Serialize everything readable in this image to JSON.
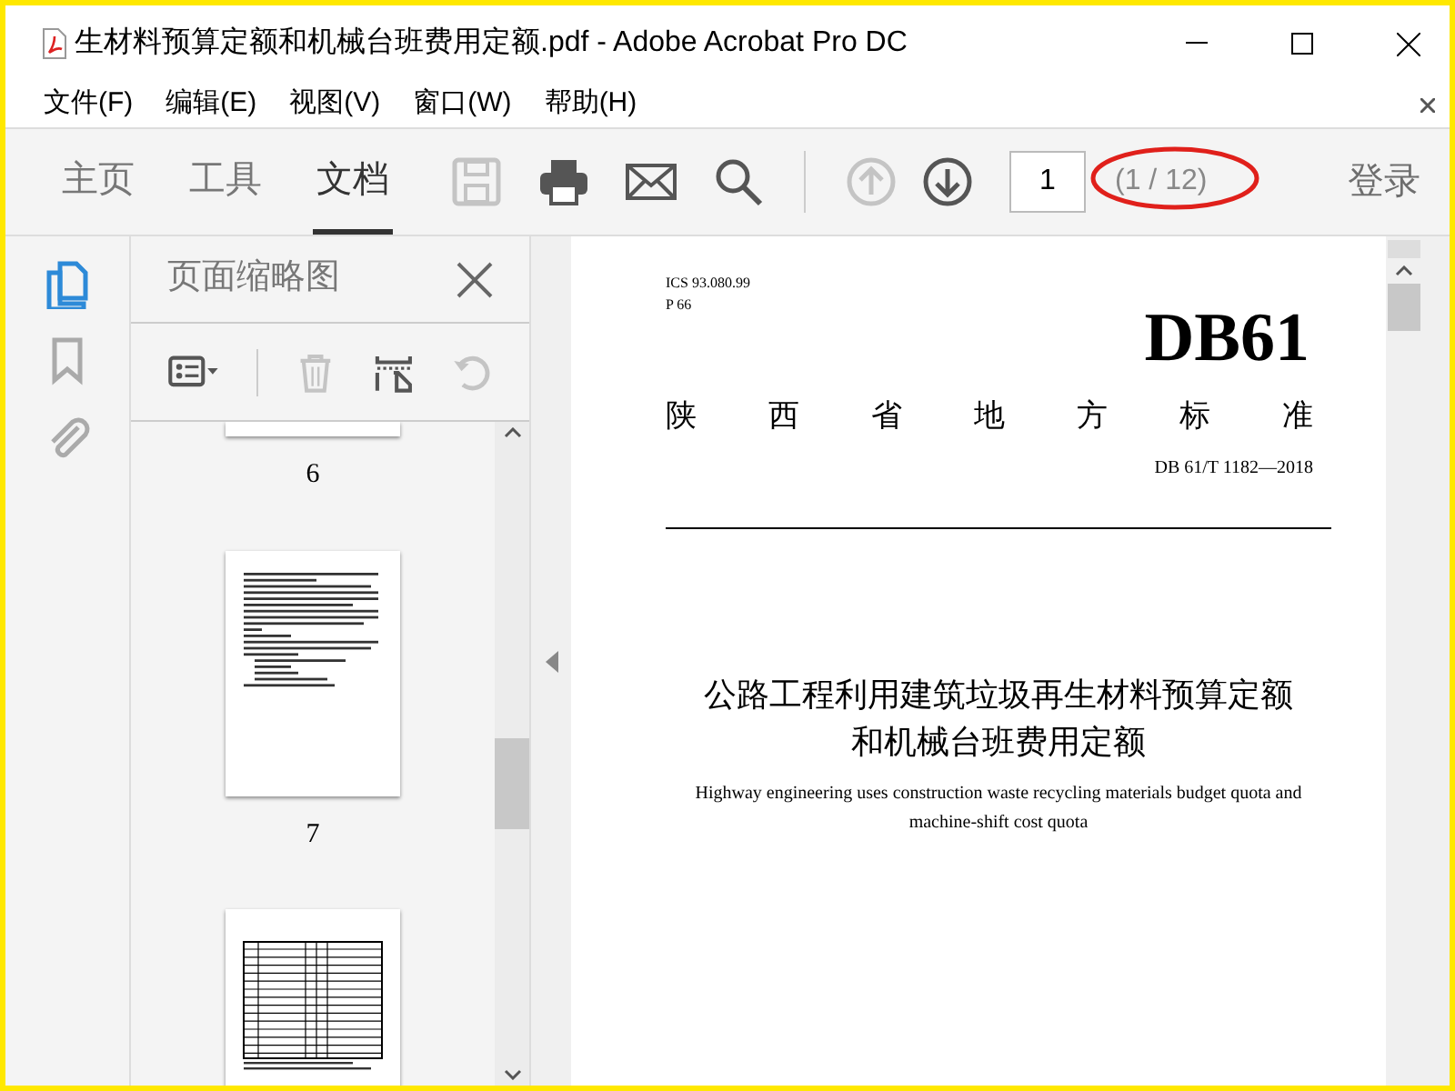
{
  "window": {
    "title": "生材料预算定额和机械台班费用定额.pdf - Adobe Acrobat Pro DC"
  },
  "menu": [
    "文件(F)",
    "编辑(E)",
    "视图(V)",
    "窗口(W)",
    "帮助(H)"
  ],
  "tabs": [
    {
      "label": "主页",
      "selected": false
    },
    {
      "label": "工具",
      "selected": false
    },
    {
      "label": "文档",
      "selected": true
    }
  ],
  "toolbar": [
    {
      "kind": "save",
      "disabled": true
    },
    {
      "kind": "print",
      "disabled": false
    },
    {
      "kind": "mail",
      "disabled": false
    },
    {
      "kind": "search",
      "disabled": false
    },
    {
      "kind": "up",
      "disabled": true
    },
    {
      "kind": "down",
      "disabled": false
    }
  ],
  "page_field": {
    "value": "1"
  },
  "page_count": "(1 / 12)",
  "sign_in": "登录",
  "rail": [
    {
      "kind": "pages",
      "selected": true
    },
    {
      "kind": "bookmark",
      "selected": false
    },
    {
      "kind": "attach",
      "selected": false
    }
  ],
  "panel": {
    "title": "页面缩略图",
    "tools": [
      {
        "kind": "options",
        "disabled": false
      },
      {
        "kind": "delete",
        "disabled": true
      },
      {
        "kind": "extract",
        "disabled": false
      },
      {
        "kind": "rotate",
        "disabled": true
      }
    ],
    "thumbnails": [
      {
        "kind": "tail",
        "label": "6"
      },
      {
        "kind": "text",
        "label": "7"
      },
      {
        "kind": "table"
      }
    ]
  },
  "document": {
    "meta": [
      "ICS 93.080.99",
      "P 66"
    ],
    "code": "DB61",
    "authority": [
      "陕",
      "西",
      "省",
      "地",
      "方",
      "标",
      "准"
    ],
    "number": "DB 61/T 1182—2018",
    "title_zh": [
      "公路工程利用建筑垃圾再生材料预算定额",
      "和机械台班费用定额"
    ],
    "title_en": [
      "Highway engineering uses construction waste recycling materials budget quota and",
      "machine-shift cost quota"
    ]
  }
}
